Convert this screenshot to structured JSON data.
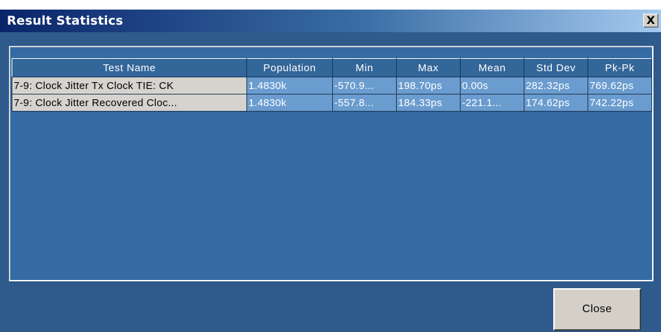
{
  "window": {
    "title": "Result Statistics",
    "close_glyph": "X",
    "titlebar_colors": [
      "#0a246a",
      "#a6caf0"
    ],
    "background": "#2f5a8c"
  },
  "table": {
    "columns": [
      "Test Name",
      "Population",
      "Min",
      "Max",
      "Mean",
      "Std Dev",
      "Pk-Pk"
    ],
    "rows": [
      [
        "7-9: Clock Jitter Tx Clock TIE: CK",
        "1.4830k",
        "-570.9...",
        "198.70ps",
        "0.00s",
        "282.32ps",
        "769.62ps"
      ],
      [
        "7-9: Clock Jitter Recovered Cloc...",
        "1.4830k",
        "-557.8...",
        "184.33ps",
        "-221.1...",
        "174.62ps",
        "742.22ps"
      ]
    ]
  },
  "buttons": {
    "close_label": "Close"
  }
}
